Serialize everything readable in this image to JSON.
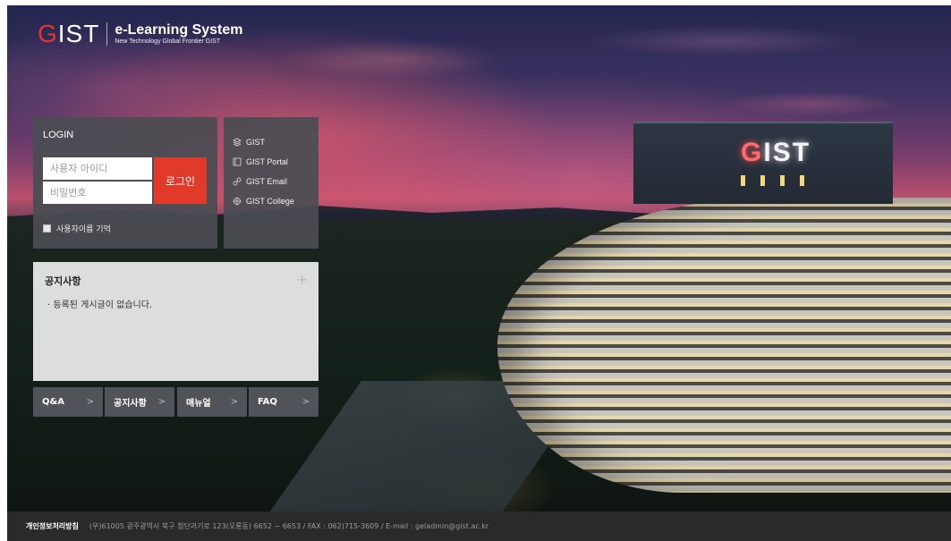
{
  "brand": {
    "logo_mark_first": "G",
    "logo_mark_rest": "IST",
    "title": "e-Learning System",
    "subtitle": "New Technology Global Frontier GIST",
    "accent_color": "#e8352a"
  },
  "background": {
    "building_sign_first": "G",
    "building_sign_rest": "IST"
  },
  "login": {
    "title": "LOGIN",
    "username_placeholder": "사용자 아이디",
    "password_placeholder": "비밀번호",
    "submit_label": "로그인",
    "remember_label": "사용자이름 기억"
  },
  "links": [
    {
      "label": "GIST",
      "icon": "layers-icon"
    },
    {
      "label": "GIST Portal",
      "icon": "portal-icon"
    },
    {
      "label": "GIST Email",
      "icon": "link-icon"
    },
    {
      "label": "GIST College",
      "icon": "crosshair-icon"
    }
  ],
  "notice": {
    "title": "공지사항",
    "more_icon": "plus-icon",
    "items": [
      "· 등록된 게시글이 없습니다."
    ]
  },
  "quick_links": [
    {
      "label": "Q&A"
    },
    {
      "label": "공지사항"
    },
    {
      "label": "매뉴얼"
    },
    {
      "label": "FAQ"
    }
  ],
  "footer": {
    "privacy_label": "개인정보처리방침",
    "info": "(우)61005 광주광역시 북구 첨단과기로 123(오룡동) 6652 ~ 6653 / FAX : 062)715-3609 / E-mail : geladmin@gist.ac.kr"
  }
}
